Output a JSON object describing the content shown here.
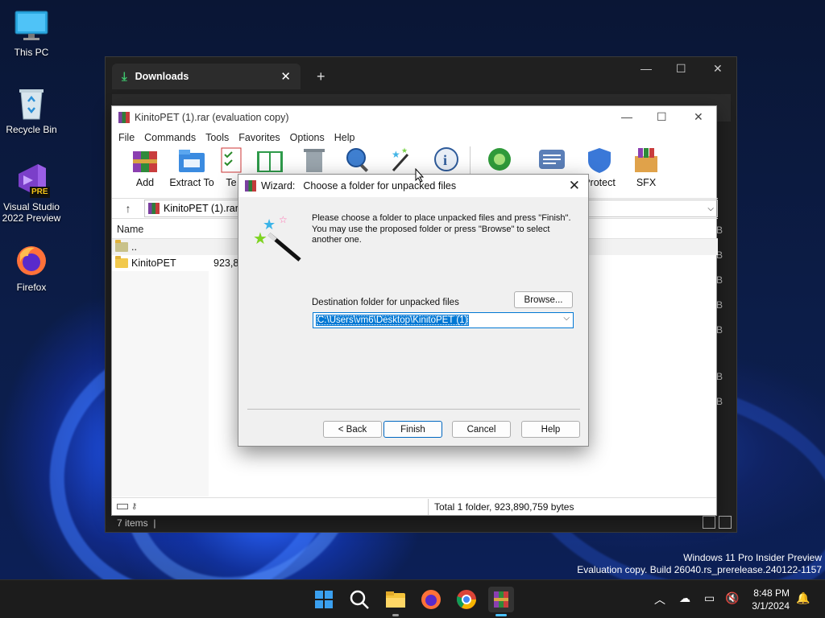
{
  "desktop": {
    "icons": [
      {
        "label": "This PC"
      },
      {
        "label": "Recycle Bin"
      },
      {
        "label": "Visual Studio 2022 Preview",
        "badge": "PRE"
      },
      {
        "label": "Firefox"
      }
    ],
    "watermark_line1": "Windows 11 Pro Insider Preview",
    "watermark_line2": "Evaluation copy. Build 26040.rs_prerelease.240122-1157"
  },
  "explorer": {
    "tab_title": "Downloads",
    "tab_close": "✕",
    "new_tab": "+",
    "status": "7 items",
    "size_suffix": "B"
  },
  "winrar": {
    "title": "KinitoPET (1).rar (evaluation copy)",
    "menu": [
      "File",
      "Commands",
      "Tools",
      "Favorites",
      "Options",
      "Help"
    ],
    "toolbar": [
      {
        "label": "Add",
        "icon": "add-archive-icon"
      },
      {
        "label": "Extract To",
        "icon": "extract-icon"
      },
      {
        "label": "Te",
        "icon": "test-icon"
      },
      {
        "label": "",
        "icon": "view-icon"
      },
      {
        "label": "",
        "icon": "delete-icon"
      },
      {
        "label": "",
        "icon": "find-icon"
      },
      {
        "label": "",
        "icon": "wizard-icon"
      },
      {
        "label": "",
        "icon": "info-icon"
      },
      {
        "label": "",
        "icon": "virus-scan-icon"
      },
      {
        "label": "",
        "icon": "comment-icon"
      },
      {
        "label": "Protect",
        "icon": "protect-icon"
      },
      {
        "label": "SFX",
        "icon": "sfx-icon"
      }
    ],
    "address": "KinitoPET (1).rar",
    "column_name": "Name",
    "rows": [
      {
        "name": "..",
        "size": ""
      },
      {
        "name": "KinitoPET",
        "size": "923,8"
      }
    ],
    "status_total": "Total 1 folder, 923,890,759 bytes"
  },
  "wizard": {
    "title_prefix": "Wizard:",
    "title": "Choose a folder for unpacked files",
    "message": "Please choose a folder to place unpacked files and press \"Finish\". You may use the proposed folder or press \"Browse\" to select another one.",
    "dest_label": "Destination folder for unpacked files",
    "dest_value": "C:\\Users\\vm6\\Desktop\\KinitoPET (1)",
    "browse_label": "Browse...",
    "back_label": "< Back",
    "finish_label": "Finish",
    "cancel_label": "Cancel",
    "help_label": "Help"
  },
  "taskbar": {
    "time": "8:48 PM",
    "date": "3/1/2024",
    "apps": [
      "start-icon",
      "search-icon",
      "file-explorer-icon",
      "firefox-icon",
      "chrome-icon",
      "winrar-icon"
    ]
  },
  "colors": {
    "accent": "#0078d4",
    "taskbar": "#1c1c1c",
    "explorer_dark": "#202020"
  }
}
